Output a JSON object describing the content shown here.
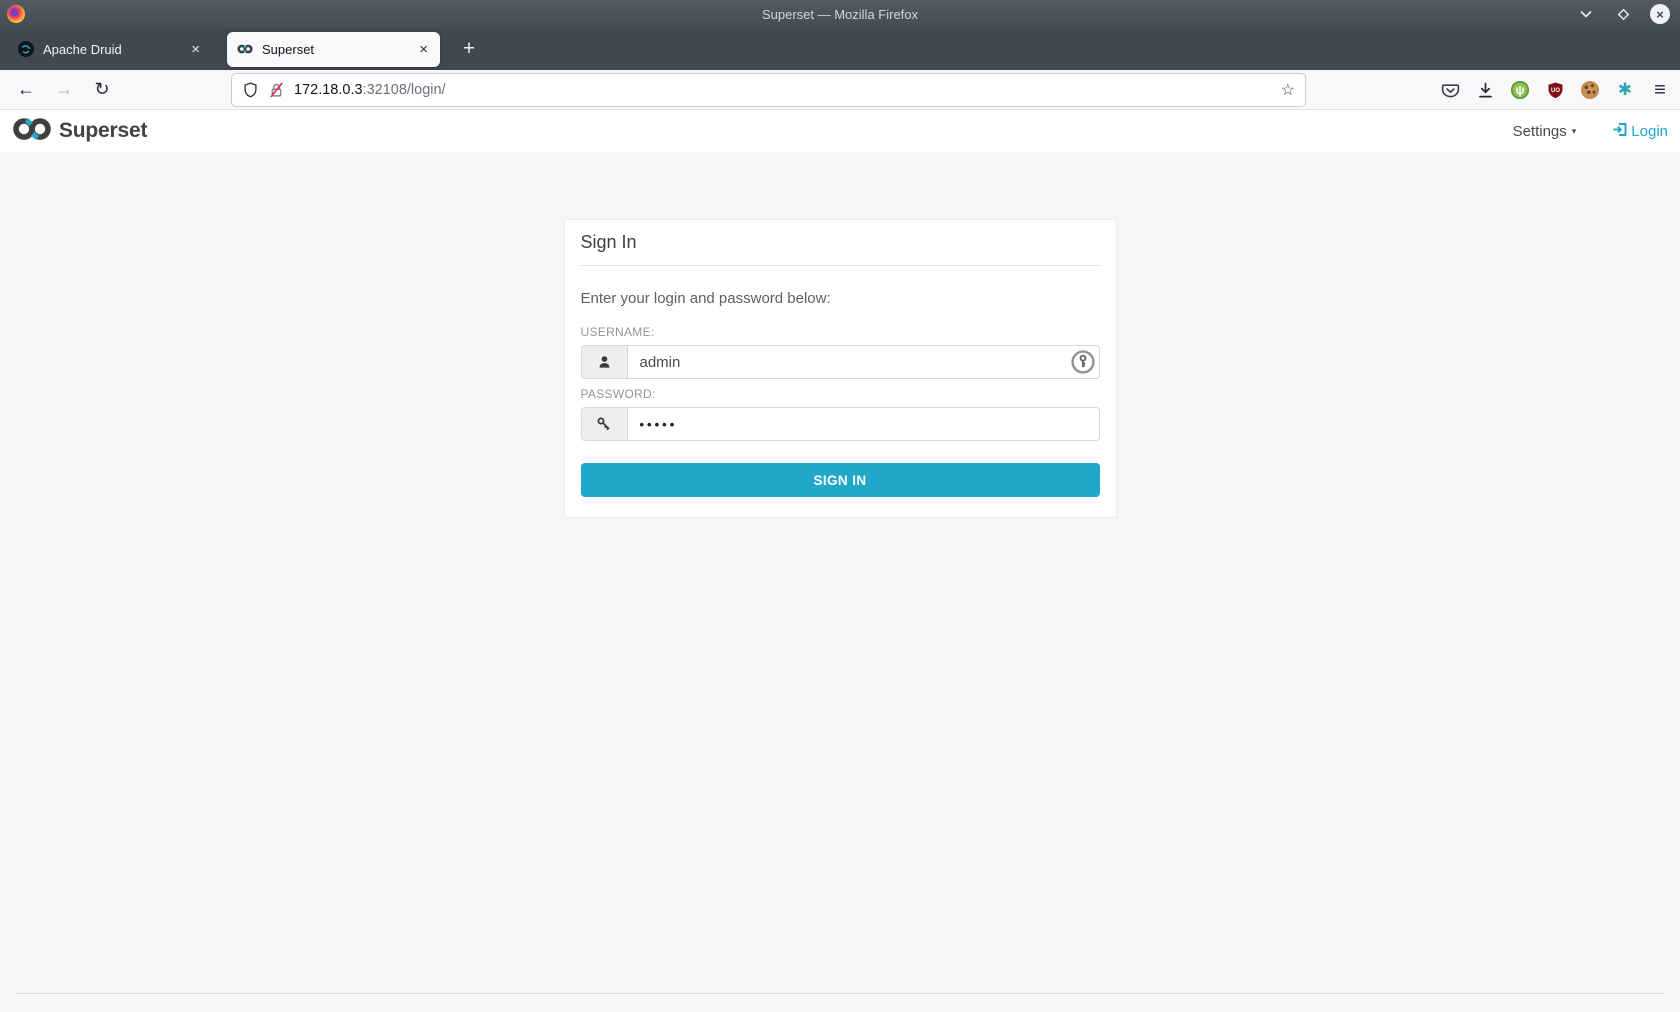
{
  "window": {
    "title": "Superset — Mozilla Firefox"
  },
  "browser": {
    "tabs": [
      {
        "label": "Apache Druid",
        "active": false
      },
      {
        "label": "Superset",
        "active": true
      }
    ],
    "url": {
      "host": "172.18.0.3",
      "path": ":32108/login/"
    }
  },
  "navbar": {
    "brand": "Superset",
    "settings_label": "Settings",
    "login_label": "Login"
  },
  "signin": {
    "title": "Sign In",
    "instructions": "Enter your login and password below:",
    "username_label": "USERNAME:",
    "username_value": "admin",
    "password_label": "PASSWORD:",
    "password_value": "•••••",
    "button_label": "SIGN IN"
  },
  "glyphs": {
    "back": "←",
    "forward": "→",
    "reload": "↻",
    "star": "☆",
    "menu": "≡",
    "new_tab": "+",
    "close_tab": "×",
    "close_window": "×",
    "settings_caret": "▾",
    "ublock_text": "UO",
    "asterisk": "✱",
    "green_ext": "ψ"
  },
  "colors": {
    "accent": "#20A7C9",
    "titlebar": "#474E55",
    "ublock_red": "#7F1117"
  }
}
